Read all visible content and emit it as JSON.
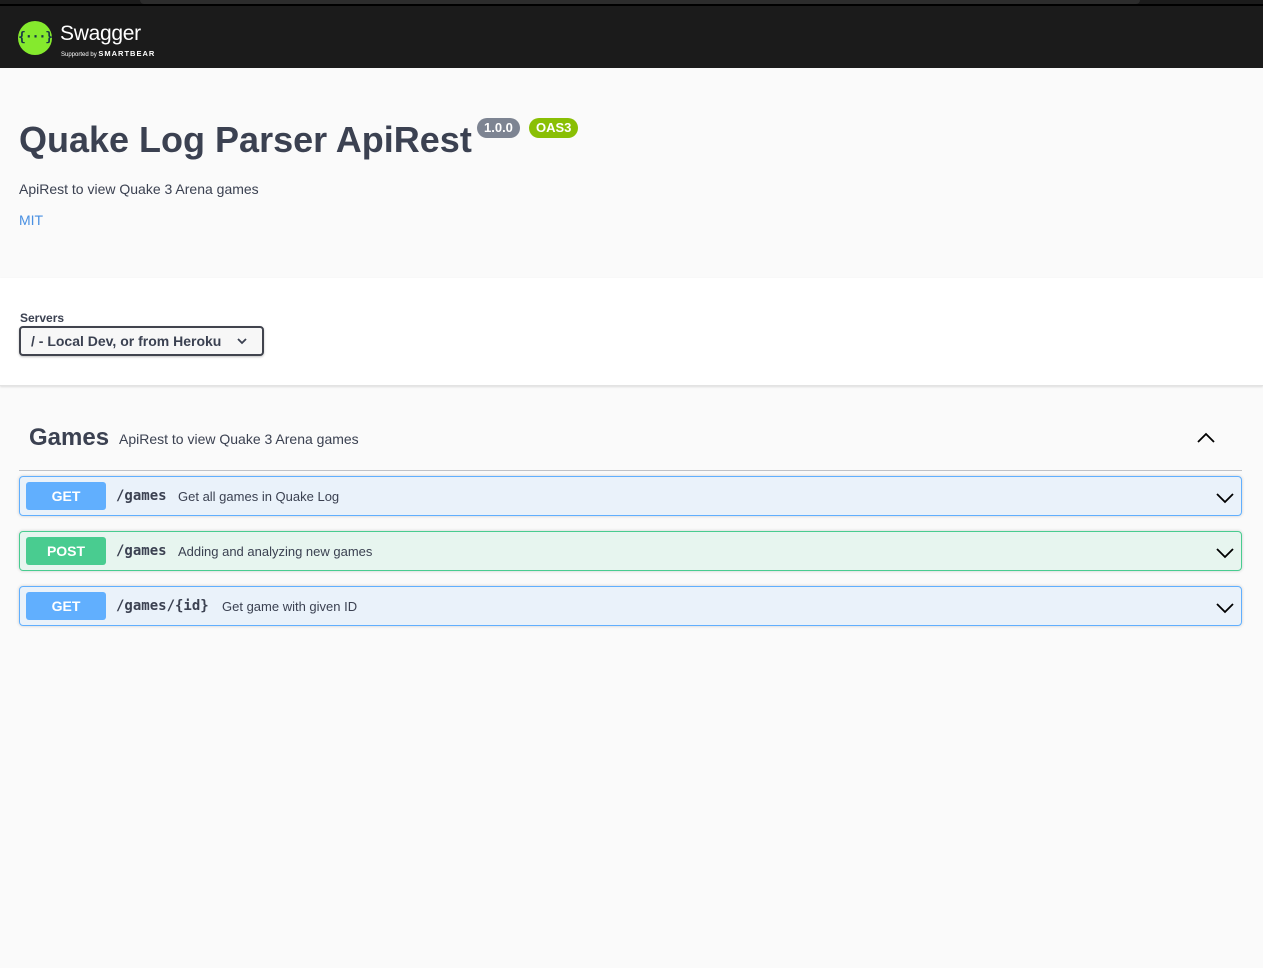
{
  "topbar": {
    "logo_glyph": "{···}",
    "brand": "Swagger",
    "supported_by": "Supported by",
    "supporter": "SMARTBEAR",
    "accent_color": "#85ea2d"
  },
  "info": {
    "title": "Quake Log Parser ApiRest",
    "version_badge": "1.0.0",
    "oas_badge": "OAS3",
    "description": "ApiRest to view Quake 3 Arena games",
    "license": "MIT"
  },
  "servers": {
    "label": "Servers",
    "selected": "/ - Local Dev, or from Heroku",
    "icon": "chevron-down-icon"
  },
  "tag": {
    "name": "Games",
    "description": "ApiRest to view Quake 3 Arena games",
    "expanded": true,
    "icon": "chevron-up-icon"
  },
  "operations": [
    {
      "method": "GET",
      "path": "/games",
      "summary": "Get all games in Quake Log",
      "color": "#61affe"
    },
    {
      "method": "POST",
      "path": "/games",
      "summary": "Adding and analyzing new games",
      "color": "#49cc90"
    },
    {
      "method": "GET",
      "path": "/games/{id}",
      "summary": "Get game with given ID",
      "color": "#61affe"
    }
  ]
}
